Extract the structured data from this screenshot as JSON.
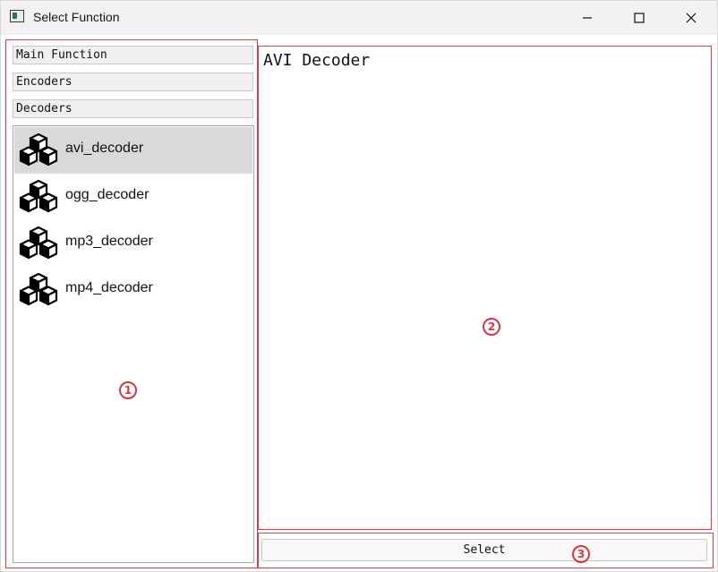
{
  "window": {
    "title": "Select Function"
  },
  "categories": [
    "Main Function",
    "Encoders",
    "Decoders"
  ],
  "functions": [
    {
      "label": "avi_decoder",
      "icon": "cubes-icon",
      "selected": true
    },
    {
      "label": "ogg_decoder",
      "icon": "cubes-icon",
      "selected": false
    },
    {
      "label": "mp3_decoder",
      "icon": "cubes-icon",
      "selected": false
    },
    {
      "label": "mp4_decoder",
      "icon": "cubes-icon",
      "selected": false
    }
  ],
  "description": "AVI Decoder",
  "actions": {
    "select_label": "Select"
  },
  "annotations": [
    "1",
    "2",
    "3"
  ],
  "colors": {
    "annotation": "#d8343e",
    "selected_row": "#d9d9d9"
  }
}
